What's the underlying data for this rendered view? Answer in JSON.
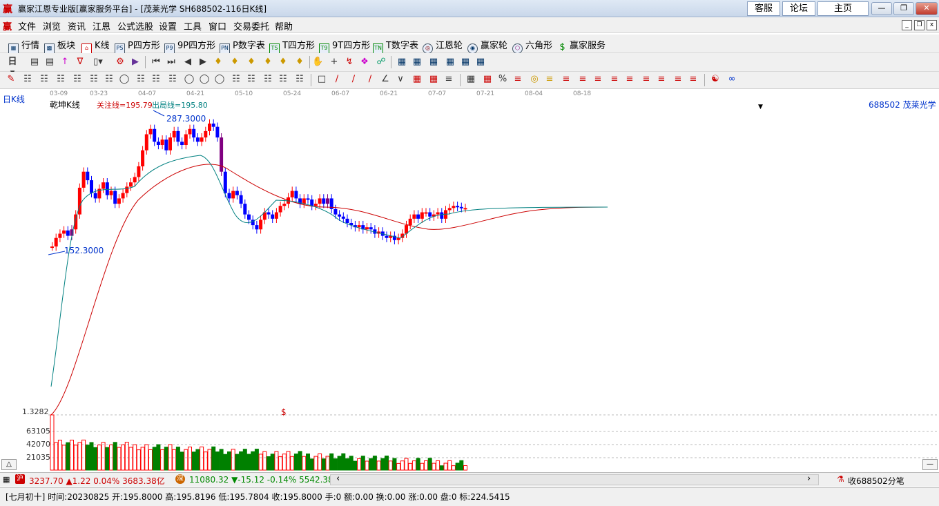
{
  "window": {
    "app_icon": "赢",
    "title": "赢家江恩专业版[赢家服务平台] - [茂莱光学  SH688502-116日K线]",
    "links": [
      "客服",
      "论坛",
      "主页"
    ]
  },
  "menu": {
    "icon": "赢",
    "items": [
      "文件",
      "浏览",
      "资讯",
      "江恩",
      "公式选股",
      "设置",
      "工具",
      "窗口",
      "交易委托",
      "帮助"
    ]
  },
  "toolbar": {
    "items": [
      {
        "label": "行情",
        "icon": "quote-icon"
      },
      {
        "label": "板块",
        "icon": "sector-icon"
      },
      {
        "label": "K线",
        "icon": "kline-icon"
      },
      {
        "label": "P四方形",
        "icon": "PS"
      },
      {
        "label": "9P四方形",
        "icon": "P9"
      },
      {
        "label": "P数字表",
        "icon": "PN"
      },
      {
        "label": "T四方形",
        "icon": "TS"
      },
      {
        "label": "9T四方形",
        "icon": "T9"
      },
      {
        "label": "T数字表",
        "icon": "TN"
      },
      {
        "label": "江恩轮",
        "icon": "gann-wheel-icon"
      },
      {
        "label": "赢家轮",
        "icon": "winner-wheel-icon"
      },
      {
        "label": "六角形",
        "icon": "hexagon-icon"
      },
      {
        "label": "赢家服务",
        "icon": "$"
      }
    ]
  },
  "chart": {
    "period_label": "日K线",
    "indicator_name": "乾坤K线",
    "focus_line": "关注线=195.79",
    "exit_line": "出局线=195.80",
    "stock": "688502 茂莱光学",
    "high_label": "287.3000",
    "low_label": "152.3000",
    "dates": [
      "03-09",
      "03-23",
      "04-07",
      "04-21",
      "05-10",
      "05-24",
      "06-07",
      "06-21",
      "07-07",
      "07-21",
      "08-04",
      "08-18"
    ],
    "volume_labels": [
      "1.3282",
      "63105",
      "42070",
      "21035"
    ],
    "dollar_marker": "$",
    "colors": {
      "up": "#ff0000",
      "down": "#0000ff",
      "flat": "#800080",
      "ma_fast": "#008080",
      "ma_slow": "#cc0000",
      "vol_up": "#ff0000",
      "vol_down": "#008000"
    }
  },
  "status": {
    "index1_icon": "沪",
    "index1": "3237.70 ▲1.22 0.04% 3683.38亿",
    "index2_icon": "深",
    "index2": "11080.32 ▼-15.12 -0.14% 5542.38",
    "tick_label": "收688502分笔",
    "info": "[七月初十] 时间:20230825 开:195.8000 高:195.8196 低:195.7804 收:195.8000 手:0 额:0.00 换:0.00 涨:0.00 盘:0 标:224.5415"
  }
}
